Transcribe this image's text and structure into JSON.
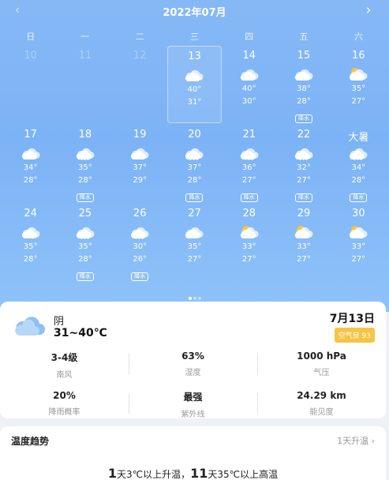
{
  "calendar": {
    "month_title": "2022年07月",
    "prev_arrow": "‹",
    "next_arrow": "›",
    "weekdays": [
      "日",
      "一",
      "二",
      "三",
      "四",
      "五",
      "六"
    ],
    "rows": [
      [
        {
          "day": "10",
          "faded": true
        },
        {
          "day": "11",
          "faded": true
        },
        {
          "day": "12",
          "faded": true
        },
        {
          "day": "13",
          "icon": "cloud-icon",
          "hi": "40°",
          "lo": "31°",
          "selected": true
        },
        {
          "day": "14",
          "icon": "cloud-icon",
          "hi": "40°",
          "lo": "30°"
        },
        {
          "day": "15",
          "icon": "cloud-icon",
          "hi": "38°",
          "lo": "28°",
          "rain": "降水"
        },
        {
          "day": "16",
          "icon": "partly-sunny-icon",
          "hi": "35°",
          "lo": "27°"
        }
      ],
      [
        {
          "day": "17",
          "icon": "cloud-icon",
          "hi": "34°",
          "lo": "28°"
        },
        {
          "day": "18",
          "icon": "rain-cloud-icon",
          "hi": "35°",
          "lo": "28°",
          "rain": "降水"
        },
        {
          "day": "19",
          "icon": "cloud-icon",
          "hi": "37°",
          "lo": "29°"
        },
        {
          "day": "20",
          "icon": "rain-cloud-icon",
          "hi": "37°",
          "lo": "28°",
          "rain": "降水"
        },
        {
          "day": "21",
          "icon": "rain-cloud-icon",
          "hi": "36°",
          "lo": "27°",
          "rain": "降水"
        },
        {
          "day": "22",
          "icon": "rain-cloud-icon",
          "hi": "32°",
          "lo": "27°",
          "rain": "降水"
        },
        {
          "day": "大暑",
          "icon": "rain-cloud-icon",
          "hi": "34°",
          "lo": "28°",
          "rain": "降水"
        }
      ],
      [
        {
          "day": "24",
          "icon": "cloud-icon",
          "hi": "35°",
          "lo": "28°"
        },
        {
          "day": "25",
          "icon": "rain-cloud-icon",
          "hi": "35°",
          "lo": "28°",
          "rain": "降水"
        },
        {
          "day": "26",
          "icon": "rain-cloud-icon",
          "hi": "30°",
          "lo": "26°",
          "rain": "降水"
        },
        {
          "day": "27",
          "icon": "cloud-icon",
          "hi": "35°",
          "lo": "27°"
        },
        {
          "day": "28",
          "icon": "partly-sunny-icon",
          "hi": "33°",
          "lo": "27°"
        },
        {
          "day": "29",
          "icon": "partly-sunny-icon",
          "hi": "33°",
          "lo": "27°"
        },
        {
          "day": "30",
          "icon": "partly-sunny-icon",
          "hi": "33°",
          "lo": "27°"
        }
      ]
    ],
    "page_dots": 3,
    "active_dot": 0
  },
  "today": {
    "condition": "阴",
    "temp_range": "31~40℃",
    "date": "7月13日",
    "aqi": "空气良 93",
    "stats": [
      {
        "value": "3-4级",
        "label": "南风"
      },
      {
        "value": "63%",
        "label": "湿度"
      },
      {
        "value": "1000 hPa",
        "label": "气压"
      },
      {
        "value": "20%",
        "label": "降雨概率"
      },
      {
        "value": "最强",
        "label": "紫外线"
      },
      {
        "value": "24.29 km",
        "label": "能见度"
      }
    ]
  },
  "trend": {
    "title": "温度趋势",
    "link": "1天升温 ›",
    "summary_n1": "1",
    "summary_t1": "天3℃以上升温，",
    "summary_n2": "11",
    "summary_t2": "天35℃以上高温"
  },
  "colors": {
    "sky_top": "#86b8f5",
    "aqi_badge": "#f6c445",
    "sun": "#f9c53a"
  }
}
